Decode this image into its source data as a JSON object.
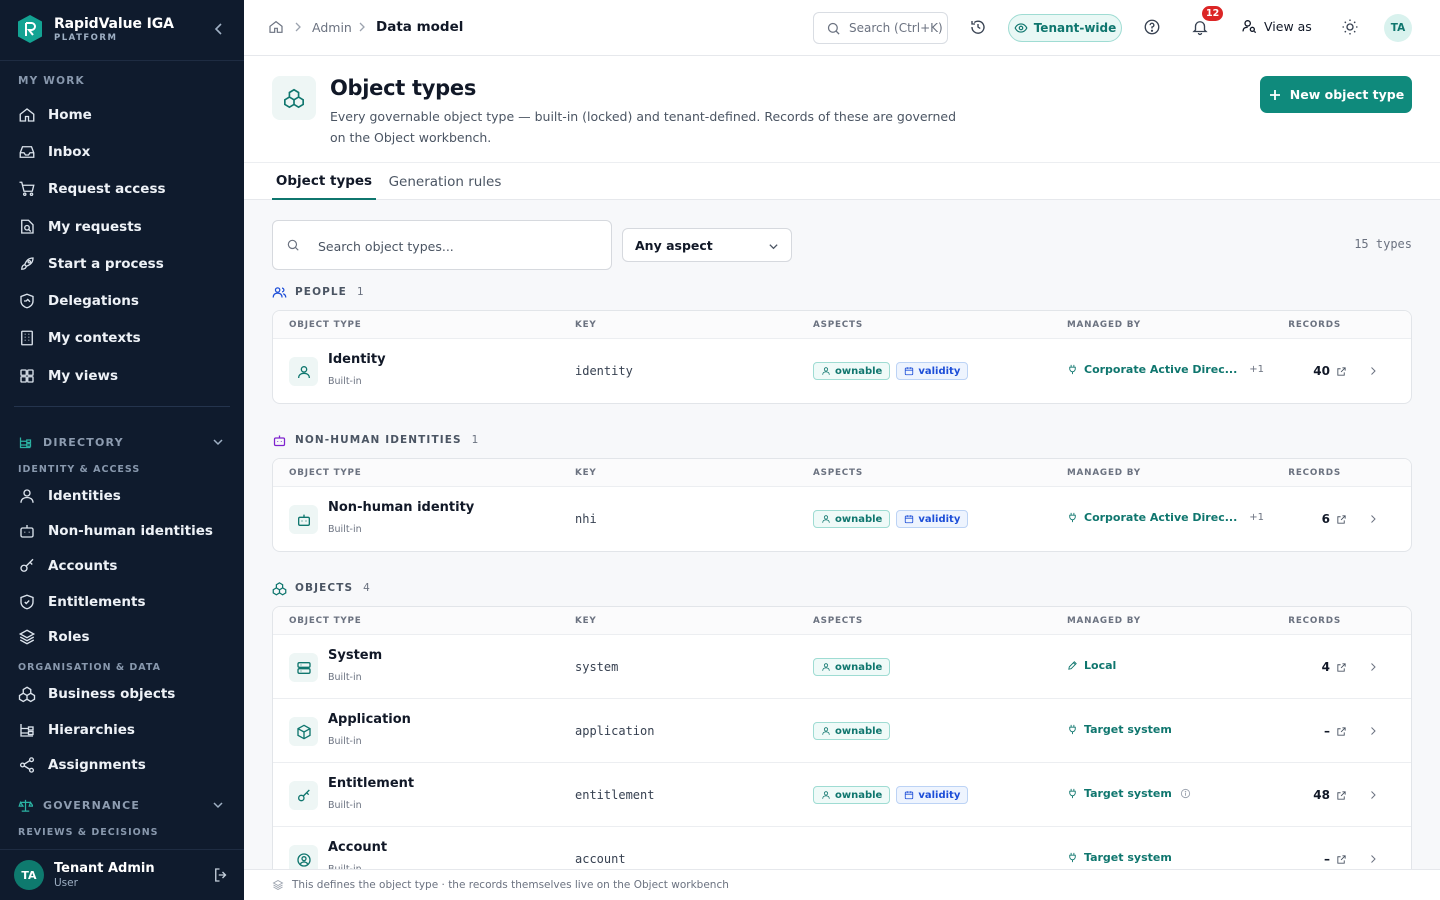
{
  "brand": {
    "name": "RapidValue IGA",
    "subtitle": "PLATFORM"
  },
  "sidebar": {
    "my_work_label": "MY WORK",
    "my_work": [
      {
        "label": "Home",
        "icon": "home-icon"
      },
      {
        "label": "Inbox",
        "icon": "inbox-icon"
      },
      {
        "label": "Request access",
        "icon": "cart-icon"
      },
      {
        "label": "My requests",
        "icon": "tag-icon"
      },
      {
        "label": "Start a process",
        "icon": "rocket-icon"
      },
      {
        "label": "Delegations",
        "icon": "shield-icon"
      },
      {
        "label": "My contexts",
        "icon": "building-icon"
      },
      {
        "label": "My views",
        "icon": "grid-icon"
      }
    ],
    "directory": {
      "label": "DIRECTORY",
      "sub_label": "IDENTITY & ACCESS",
      "items": [
        {
          "label": "Identities",
          "icon": "user-icon"
        },
        {
          "label": "Non-human identities",
          "icon": "bot-icon"
        },
        {
          "label": "Accounts",
          "icon": "key-icon"
        },
        {
          "label": "Entitlements",
          "icon": "shield-check-icon"
        },
        {
          "label": "Roles",
          "icon": "layers-icon"
        }
      ],
      "sub_label_2": "ORGANISATION & DATA",
      "items_2": [
        {
          "label": "Business objects",
          "icon": "boxes-icon"
        },
        {
          "label": "Hierarchies",
          "icon": "hierarchy-icon"
        },
        {
          "label": "Assignments",
          "icon": "share-icon"
        }
      ]
    },
    "governance": {
      "label": "GOVERNANCE",
      "sub_label": "REVIEWS & DECISIONS"
    },
    "user": {
      "initials": "TA",
      "name": "Tenant Admin",
      "role": "User"
    }
  },
  "topbar": {
    "breadcrumb": {
      "admin": "Admin",
      "current": "Data model"
    },
    "search_placeholder": "Search (Ctrl+K)",
    "tenant_pill": "Tenant-wide",
    "notification_count": "12",
    "view_as": "View as",
    "avatar_initials": "TA"
  },
  "page": {
    "title": "Object types",
    "description": "Every governable object type — built-in (locked) and tenant-defined. Records of these are governed on the Object workbench.",
    "new_button": "New object type"
  },
  "tabs": [
    {
      "label": "Object types",
      "active": true
    },
    {
      "label": "Generation rules",
      "active": false
    }
  ],
  "filters": {
    "search_placeholder": "Search object types...",
    "aspect_selected": "Any aspect",
    "count_text": "15 types"
  },
  "table_columns": [
    "OBJECT TYPE",
    "KEY",
    "ASPECTS",
    "MANAGED BY",
    "RECORDS"
  ],
  "groups": [
    {
      "title": "PEOPLE",
      "count": "1",
      "icon": "users-icon",
      "rows": [
        {
          "name": "Identity",
          "sub": "Built-in",
          "key": "identity",
          "icon": "user-icon",
          "aspects": [
            "ownable",
            "validity"
          ],
          "managed_by": "Corporate Active Direc...",
          "managed_extra": "+1",
          "managed_icon": "plug-icon",
          "records": "40"
        }
      ]
    },
    {
      "title": "NON-HUMAN IDENTITIES",
      "count": "1",
      "icon": "bot-icon",
      "rows": [
        {
          "name": "Non-human identity",
          "sub": "Built-in",
          "key": "nhi",
          "icon": "bot-icon",
          "aspects": [
            "ownable",
            "validity"
          ],
          "managed_by": "Corporate Active Direc...",
          "managed_extra": "+1",
          "managed_icon": "plug-icon",
          "records": "6"
        }
      ]
    },
    {
      "title": "OBJECTS",
      "count": "4",
      "icon": "boxes-icon",
      "rows": [
        {
          "name": "System",
          "sub": "Built-in",
          "key": "system",
          "icon": "server-icon",
          "aspects": [
            "ownable"
          ],
          "managed_by": "Local",
          "managed_extra": "",
          "managed_icon": "pencil-icon",
          "records": "4"
        },
        {
          "name": "Application",
          "sub": "Built-in",
          "key": "application",
          "icon": "cube-icon",
          "aspects": [
            "ownable"
          ],
          "managed_by": "Target system",
          "managed_extra": "",
          "managed_icon": "plug-icon",
          "records": "–"
        },
        {
          "name": "Entitlement",
          "sub": "Built-in",
          "key": "entitlement",
          "icon": "key-icon",
          "aspects": [
            "ownable",
            "validity"
          ],
          "managed_by": "Target system",
          "managed_extra": "",
          "managed_icon": "plug-icon",
          "managed_info": true,
          "records": "48"
        },
        {
          "name": "Account",
          "sub": "Built-in",
          "key": "account",
          "icon": "user-circle-icon",
          "aspects": [],
          "managed_by": "Target system",
          "managed_extra": "",
          "managed_icon": "plug-icon",
          "records": "–"
        }
      ]
    }
  ],
  "footer": {
    "text": "This defines the object type · the records themselves live on the Object workbench"
  }
}
